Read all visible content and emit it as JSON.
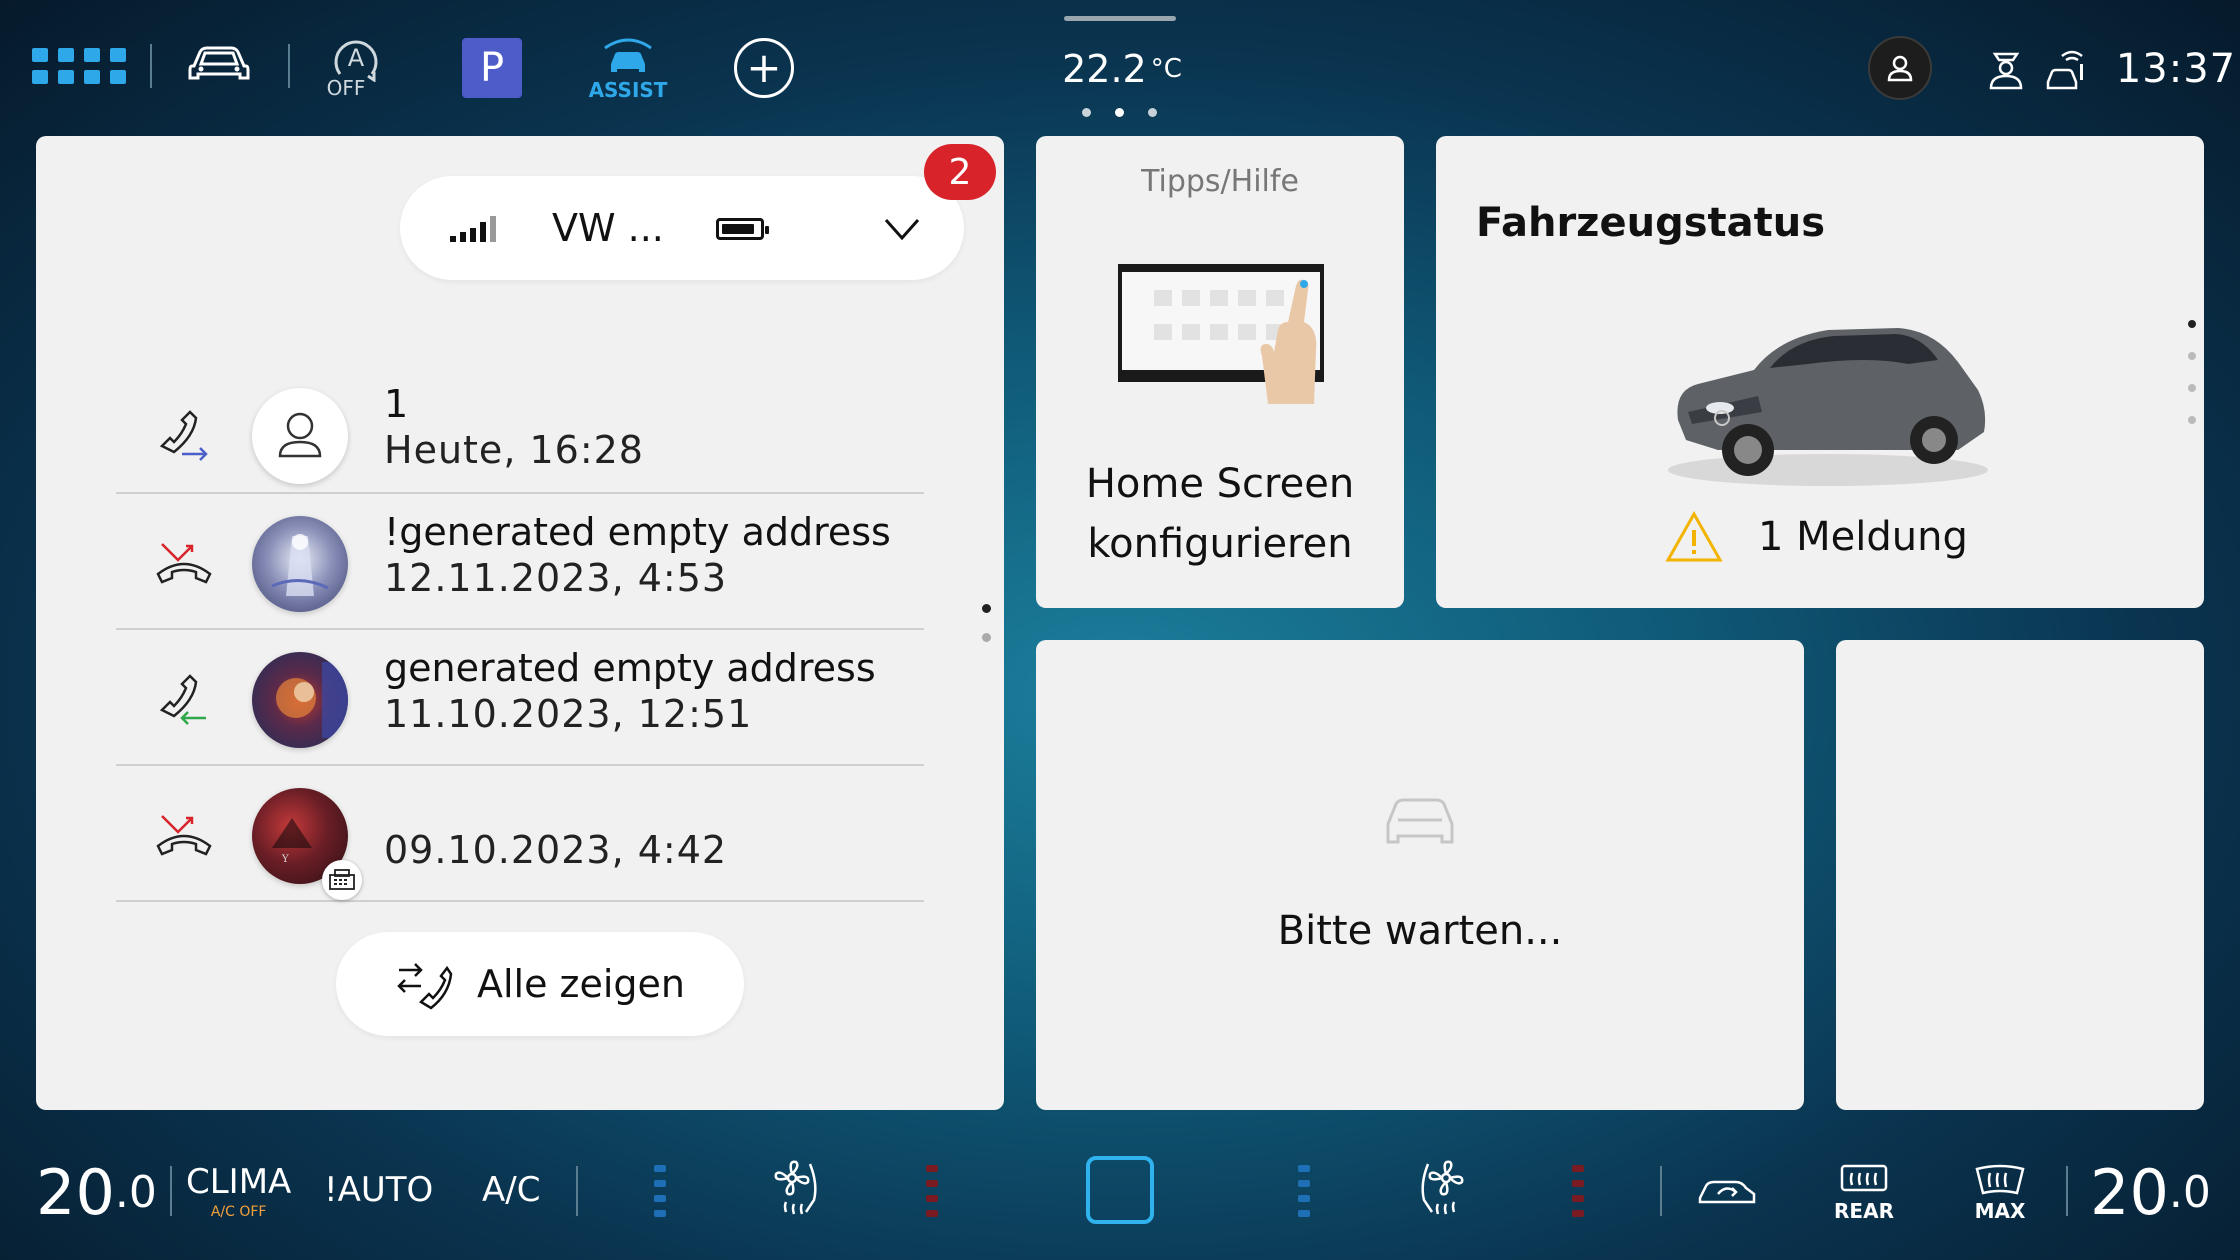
{
  "topbar": {
    "autohold_label": "OFF",
    "park_label": "P",
    "assist_label": "ASSIST",
    "plus_label": "+",
    "temperature": "22.2",
    "temperature_unit": "°C",
    "clock": "13:37"
  },
  "phone": {
    "device_name": "VW ...",
    "badge_count": "2",
    "calls": [
      {
        "type": "outgoing",
        "name": "1",
        "time": "Heute, 16:28"
      },
      {
        "type": "missed",
        "name": "!generated empty address",
        "time": "12.11.2023, 4:53"
      },
      {
        "type": "incoming",
        "name": "generated empty address",
        "time": "11.10.2023, 12:51"
      },
      {
        "type": "missed",
        "name": "",
        "time": "09.10.2023, 4:42"
      }
    ],
    "show_all_label": "Alle zeigen"
  },
  "tips": {
    "title": "Tipps/Hilfe",
    "line1": "Home Screen",
    "line2": "konfigurieren"
  },
  "status": {
    "title": "Fahrzeugstatus",
    "message": "1 Meldung"
  },
  "wait": {
    "text": "Bitte warten..."
  },
  "climate": {
    "left_temp": "20",
    "left_temp_decimal": ".0",
    "clima_label": "CLIMA",
    "ac_off_label": "A/C OFF",
    "auto_label": "!AUTO",
    "ac_label": "A/C",
    "rear_label": "REAR",
    "max_label": "MAX",
    "right_temp": "20",
    "right_temp_decimal": ".0"
  },
  "colors": {
    "accent_blue": "#2fa8ea",
    "badge_red": "#d8232a",
    "park_blue": "#4d5cc9",
    "warning_yellow": "#f2b400"
  }
}
